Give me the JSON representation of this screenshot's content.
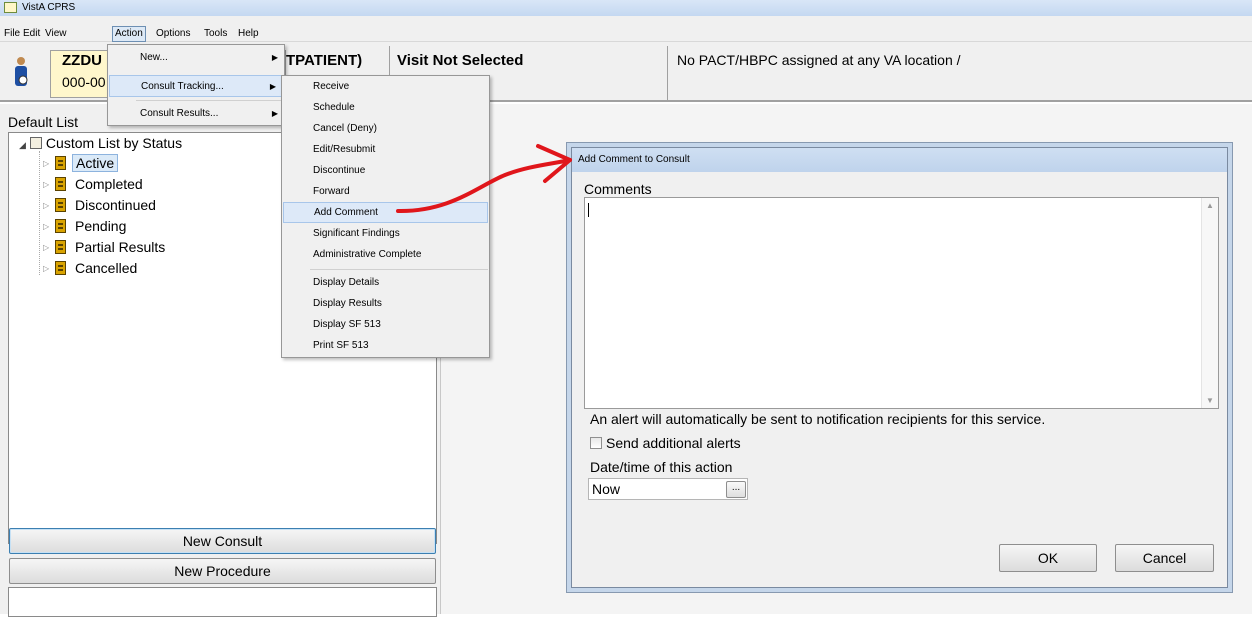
{
  "window": {
    "title": "VistA CPRS"
  },
  "menubar": [
    "File",
    "Edit",
    "View",
    "Action",
    "Options",
    "Tools",
    "Help"
  ],
  "patient": {
    "name": "ZZDU",
    "ssn": "000-00",
    "status": "TPATIENT)",
    "visit": "Visit Not Selected",
    "pact": "No PACT/HBPC assigned at any VA location /"
  },
  "action_menu": {
    "items": [
      {
        "label": "New...",
        "submenu": true
      },
      {
        "label": "Consult Tracking...",
        "submenu": true
      },
      {
        "label": "Consult Results...",
        "submenu": true
      }
    ]
  },
  "consult_tracking_menu": {
    "items": [
      "Receive",
      "Schedule",
      "Cancel (Deny)",
      "Edit/Resubmit",
      "Discontinue",
      "Forward",
      "Add Comment",
      "Significant Findings",
      "Administrative Complete",
      "Display Details",
      "Display Results",
      "Display SF 513",
      "Print SF 513"
    ],
    "highlighted": "Add Comment"
  },
  "left_panel": {
    "default_list_label": "Default List",
    "tree_root": "Custom List by Status",
    "tree_items": [
      "Active",
      "Completed",
      "Discontinued",
      "Pending",
      "Partial Results",
      "Cancelled"
    ],
    "selected_item": "Active",
    "new_consult_button": "New Consult",
    "new_procedure_button": "New Procedure"
  },
  "dialog": {
    "title": "Add Comment to Consult",
    "comments_label": "Comments",
    "comments_value": "",
    "alert_note": "An alert will automatically be sent to notification recipients for this service.",
    "send_alerts_label": "Send additional alerts",
    "send_alerts_checked": false,
    "datetime_label": "Date/time of this action",
    "datetime_value": "Now",
    "ellipsis_button": "...",
    "ok_button": "OK",
    "cancel_button": "Cancel"
  },
  "colors": {
    "annotation_arrow": "#e0161b",
    "name_box": "#fff7cc",
    "selection": "#dbeaf8"
  }
}
